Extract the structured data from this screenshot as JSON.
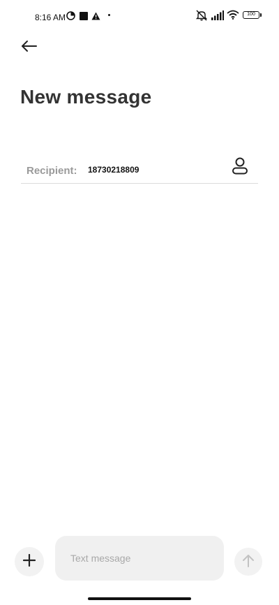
{
  "status_bar": {
    "time": "8:16 AM",
    "battery_level": "100",
    "left_icons": [
      "data-saver-icon",
      "square-notification-icon",
      "warning-icon",
      "dot-icon"
    ],
    "right_icons": [
      "mute-icon",
      "signal-icon",
      "wifi-icon",
      "battery-icon"
    ]
  },
  "header": {
    "back_icon": "back-arrow-icon",
    "title": "New message"
  },
  "recipient": {
    "label": "Recipient:",
    "value": "18730218809",
    "contact_icon": "contact-person-icon"
  },
  "composer": {
    "add_icon": "plus-icon",
    "placeholder": "Text message",
    "send_icon": "send-arrow-up-icon"
  }
}
